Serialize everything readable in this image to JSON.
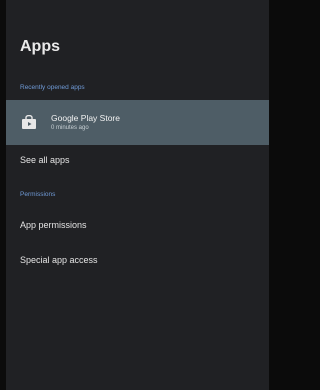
{
  "header": {
    "title": "Apps"
  },
  "sections": {
    "recent": {
      "label": "Recently opened apps"
    },
    "permissions": {
      "label": "Permissions"
    }
  },
  "recent_app": {
    "icon": "shopping-bag-icon",
    "name": "Google Play Store",
    "subtitle": "0 minutes ago"
  },
  "menu": {
    "see_all": "See all apps",
    "app_permissions": "App permissions",
    "special_access": "Special app access"
  },
  "colors": {
    "panel_bg": "#202124",
    "selected_row_bg": "#4e5d66",
    "section_header": "#6f9ad6",
    "text": "#e4e4e4"
  }
}
